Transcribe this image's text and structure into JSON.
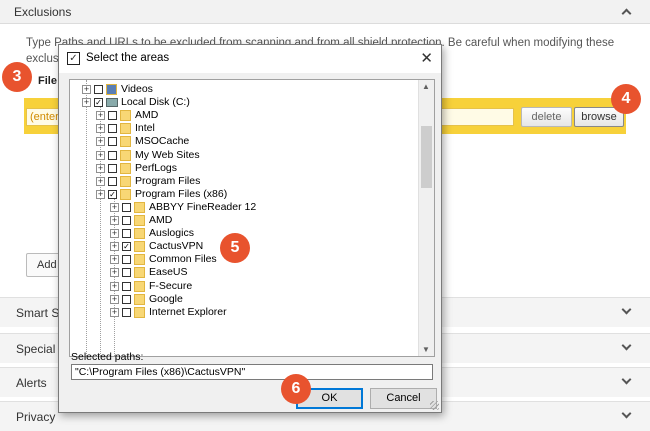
{
  "background": {
    "section_title": "Exclusions",
    "description": "Type Paths and URLs to be excluded from scanning and from all shield protection. Be careful when modifying these exclusi",
    "file_label": "File",
    "path_input_value": "(enter",
    "delete_label": "delete",
    "browse_label": "browse",
    "add_label": "Add",
    "sections": [
      "Smart Sc",
      "Special s",
      "Alerts",
      "Privacy"
    ]
  },
  "steps": [
    "3",
    "4",
    "5",
    "6"
  ],
  "dialog": {
    "title": "Select the areas",
    "close_glyph": "✕",
    "tree": [
      {
        "label": "Videos",
        "level": 1,
        "checked": false,
        "icon": "video-folder-icon"
      },
      {
        "label": "Local Disk (C:)",
        "level": 1,
        "checked": true,
        "icon": "drive-icon"
      },
      {
        "label": "AMD",
        "level": 2,
        "checked": false,
        "icon": "folder-icon"
      },
      {
        "label": "Intel",
        "level": 2,
        "checked": false,
        "icon": "folder-icon"
      },
      {
        "label": "MSOCache",
        "level": 2,
        "checked": false,
        "icon": "folder-icon"
      },
      {
        "label": "My Web Sites",
        "level": 2,
        "checked": false,
        "icon": "folder-icon"
      },
      {
        "label": "PerfLogs",
        "level": 2,
        "checked": false,
        "icon": "folder-icon"
      },
      {
        "label": "Program Files",
        "level": 2,
        "checked": false,
        "icon": "folder-icon"
      },
      {
        "label": "Program Files (x86)",
        "level": 2,
        "checked": true,
        "icon": "folder-icon"
      },
      {
        "label": "ABBYY FineReader 12",
        "level": 3,
        "checked": false,
        "icon": "folder-icon"
      },
      {
        "label": "AMD",
        "level": 3,
        "checked": false,
        "icon": "folder-icon"
      },
      {
        "label": "Auslogics",
        "level": 3,
        "checked": false,
        "icon": "folder-icon"
      },
      {
        "label": "CactusVPN",
        "level": 3,
        "checked": true,
        "icon": "folder-icon"
      },
      {
        "label": "Common Files",
        "level": 3,
        "checked": false,
        "icon": "folder-icon"
      },
      {
        "label": "EaseUS",
        "level": 3,
        "checked": false,
        "icon": "folder-icon"
      },
      {
        "label": "F-Secure",
        "level": 3,
        "checked": false,
        "icon": "folder-icon"
      },
      {
        "label": "Google",
        "level": 3,
        "checked": false,
        "icon": "folder-icon"
      },
      {
        "label": "Internet Explorer",
        "level": 3,
        "checked": false,
        "icon": "folder-icon"
      }
    ],
    "selected_paths_label": "Selected paths:",
    "selected_paths_value": "\"C:\\Program Files (x86)\\CactusVPN\"",
    "ok_label": "OK",
    "cancel_label": "Cancel"
  },
  "colors": {
    "accent_yellow": "#f7d13a",
    "step_marker": "#e8532e",
    "dialog_default_border": "#0078d7"
  }
}
